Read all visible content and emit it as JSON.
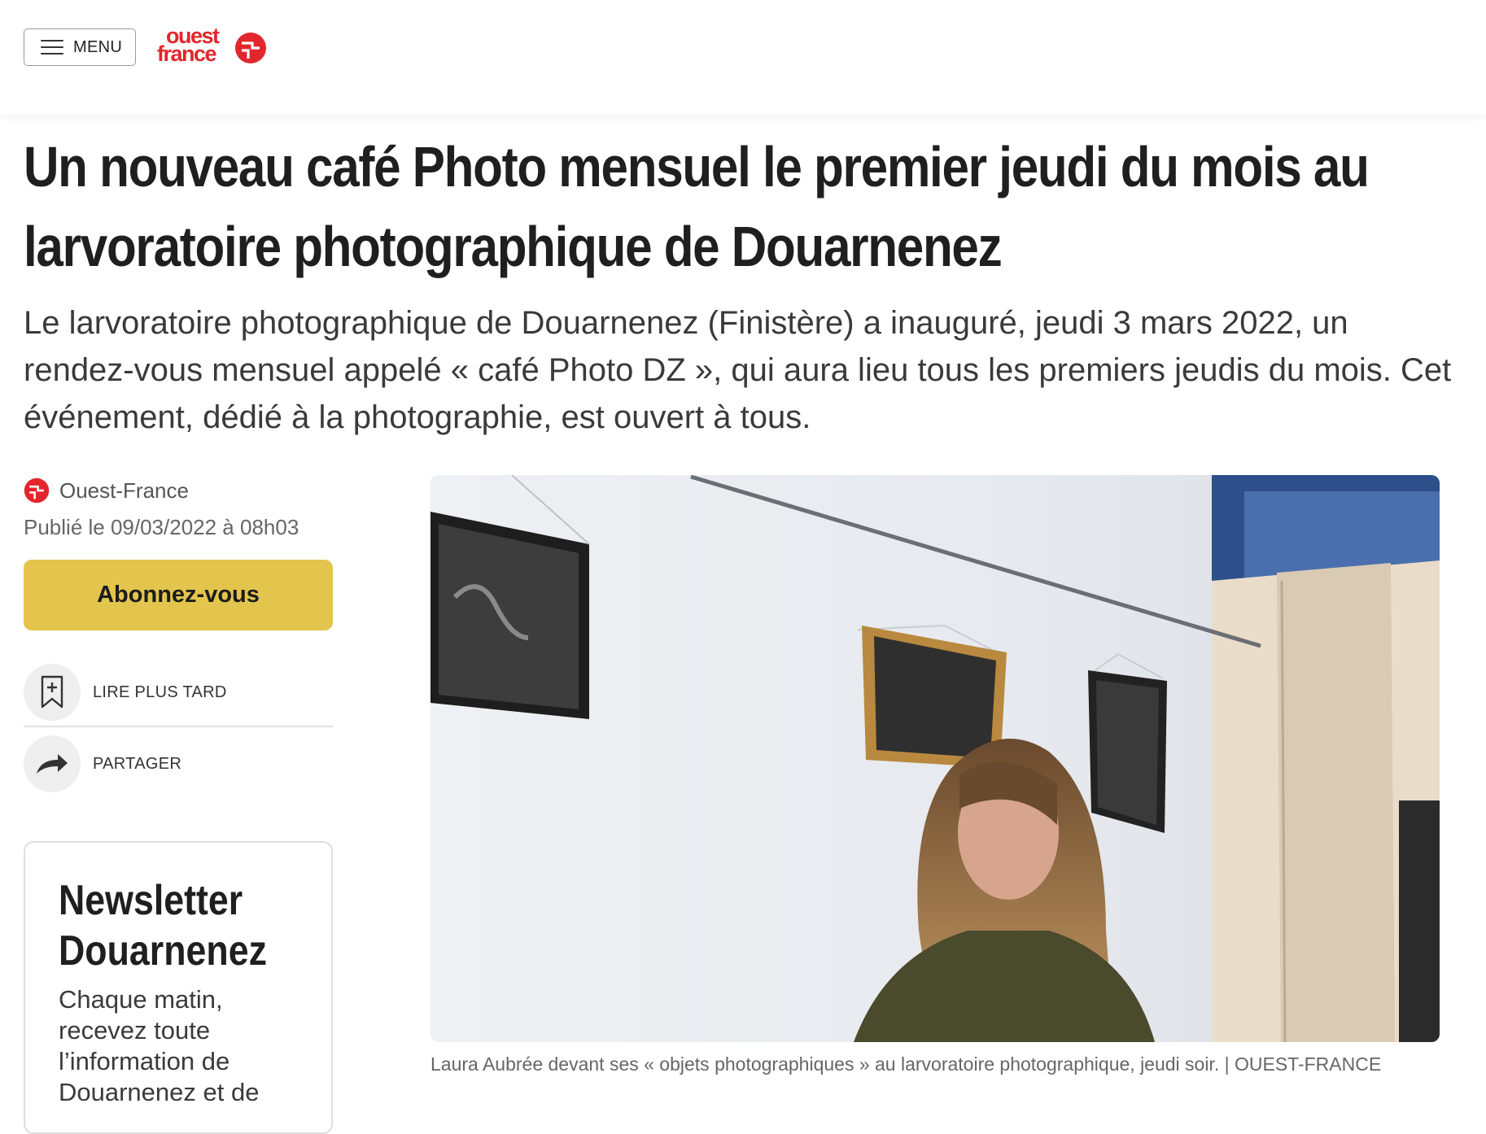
{
  "header": {
    "menu_label": "MENU",
    "logo_line1": "ouest",
    "logo_line2": "france",
    "brand_color": "#e3262c"
  },
  "article": {
    "headline": "Un nouveau café Photo mensuel le premier jeudi du mois au larvoratoire photographique de Douarnenez",
    "lead": "Le larvoratoire photographique de Douarnenez (Finistère) a inauguré, jeudi 3 mars 2022, un rendez-vous mensuel appelé « café Photo DZ », qui aura lieu tous les premiers jeudis du mois. Cet événement, dédié à la photographie, est ouvert à tous.",
    "source": "Ouest-France",
    "published": "Publié le 09/03/2022 à 08h03",
    "photo_caption": "Laura Aubrée devant ses « objets photographiques » au larvoratoire photographique, jeudi soir. | OUEST-FRANCE"
  },
  "sidebar": {
    "subscribe_label": "Abonnez-vous",
    "subscribe_color": "#e3c44d",
    "actions": [
      {
        "label": "LIRE PLUS TARD",
        "icon": "bookmark-add-icon"
      },
      {
        "label": "PARTAGER",
        "icon": "share-arrow-icon"
      }
    ],
    "newsletter": {
      "title": "Newsletter Douarnenez",
      "text": "Chaque matin, recevez toute l’information de Douarnenez et de"
    }
  }
}
